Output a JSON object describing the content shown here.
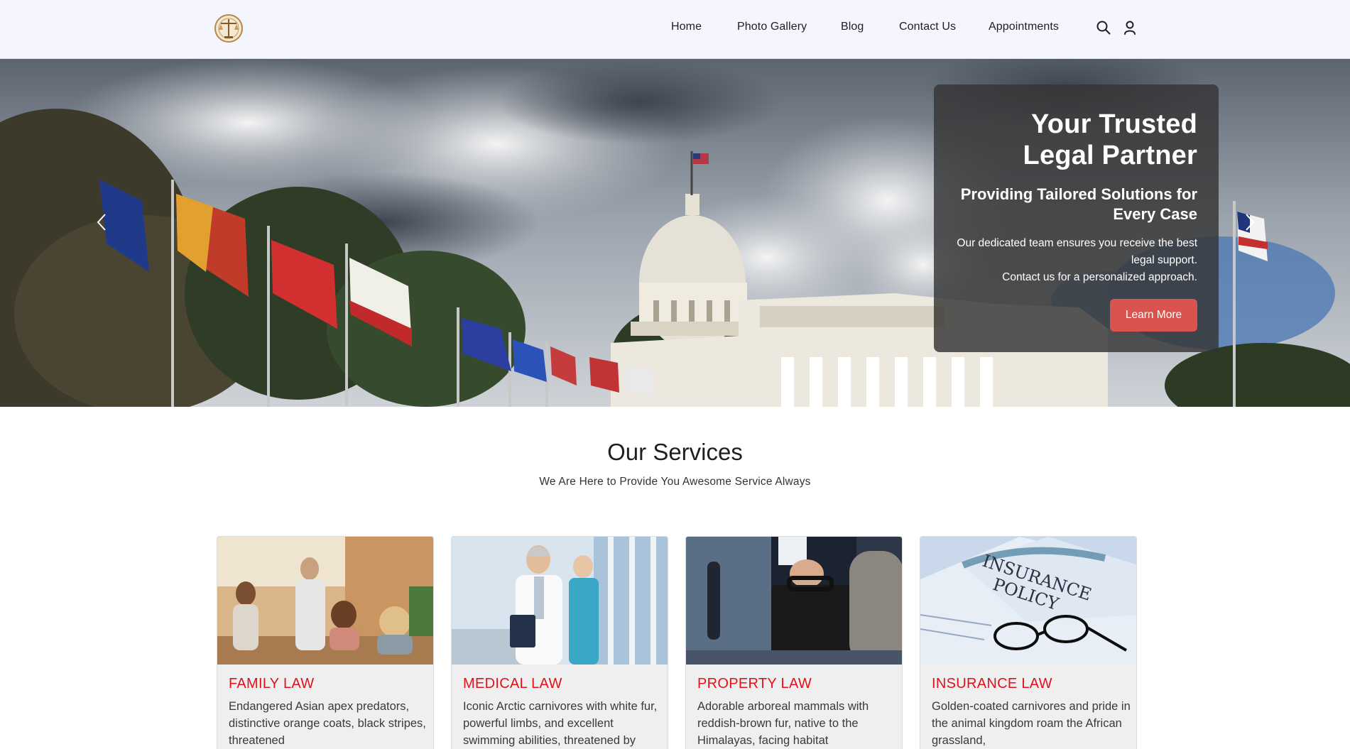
{
  "nav": {
    "logo_icon": "scales-of-justice-logo-icon",
    "links": [
      "Home",
      "Photo Gallery",
      "Blog",
      "Contact Us",
      "Appointments"
    ],
    "search_icon": "search-icon",
    "user_icon": "user-icon"
  },
  "hero": {
    "image": "capitol-building-with-flags-photo",
    "title": "Your Trusted Legal Partner",
    "subtitle": "Providing Tailored Solutions for Every Case",
    "text_line1": "Our dedicated team ensures you receive the best legal support.",
    "text_line2": "Contact us for a personalized approach.",
    "button": "Learn More",
    "button_color": "#d9534f",
    "prev_icon": "chevron-left-icon",
    "next_icon": "chevron-right-icon"
  },
  "services": {
    "title": "Our Services",
    "subtitle": "We Are Here to Provide You Awesome Service Always",
    "title_color": "#e3101a",
    "cards": [
      {
        "title": "FAMILY LAW",
        "text": "Endangered Asian apex predators, distinctive orange coats, black stripes, threatened",
        "image": "family-arguing-photo"
      },
      {
        "title": "MEDICAL LAW",
        "text": "Iconic Arctic carnivores with white fur, powerful limbs, and excellent swimming abilities, threatened by",
        "image": "doctor-and-nurse-photo"
      },
      {
        "title": "PROPERTY LAW",
        "text": "Adorable arboreal mammals with reddish-brown fur, native to the Himalayas, facing habitat",
        "image": "businessman-briefcase-photo"
      },
      {
        "title": "INSURANCE LAW",
        "text": "Golden-coated carnivores and pride in the animal kingdom roam the African grassland,",
        "image": "insurance-policy-glasses-photo"
      }
    ]
  }
}
